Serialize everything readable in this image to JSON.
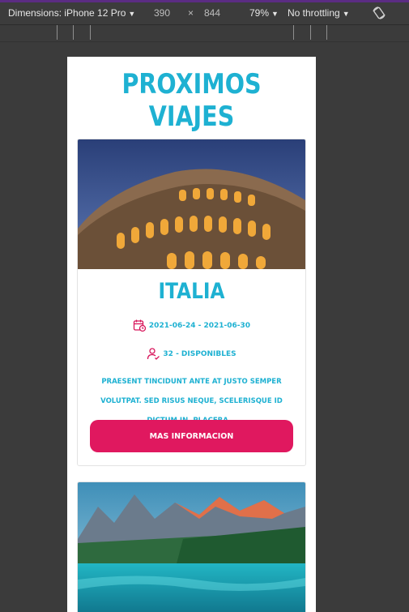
{
  "devtools": {
    "dimensions_label": "Dimensions: iPhone 12 Pro",
    "width": "390",
    "times": "×",
    "height": "844",
    "zoom": "79%",
    "throttling": "No throttling",
    "caret": "▼"
  },
  "page": {
    "title": "PROXIMOS VIAJES",
    "trips": [
      {
        "title": "ITALIA",
        "dates": "2021-06-24 - 2021-06-30",
        "availability": "32 - DISPONIBLES",
        "description": "PRAESENT TINCIDUNT ANTE AT JUSTO SEMPER VOLUTPAT. SED RISUS NEQUE, SCELERISQUE ID DICTUM IN, PLACERA...",
        "button_label": "MAS INFORMACION"
      }
    ]
  },
  "colors": {
    "accent": "#1eb1d2",
    "button": "#e0185f",
    "icon": "#d8145a"
  },
  "icons": [
    "caret-down-icon",
    "rotate-device-icon",
    "calendar-icon",
    "user-check-icon"
  ]
}
